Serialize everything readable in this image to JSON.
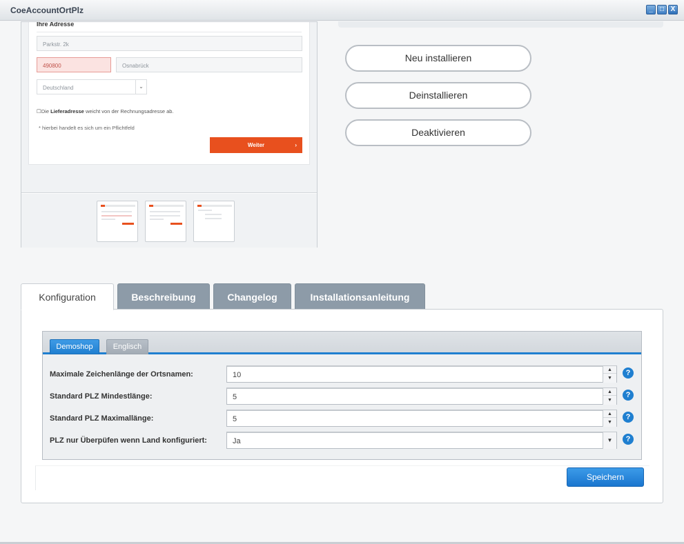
{
  "window": {
    "title": "CoeAccountOrtPlz",
    "controls": {
      "minimize": "_",
      "maximize": "□",
      "close": "X"
    }
  },
  "preview": {
    "heading": "Ihre Adresse",
    "street_value": "Parkstr. 2k",
    "zip_value": "490800",
    "city_value": "Osnabrück",
    "country_value": "Deutschland",
    "checkbox_text_pre": "Die ",
    "checkbox_text_bold": "Lieferadresse",
    "checkbox_text_post": " weicht von der Rechnungsadresse ab.",
    "required_note": "* hierbei handelt es sich um ein Pflichtfeld",
    "next_button": "Weiter",
    "next_arrow": "›",
    "thumbnail_count": 3
  },
  "actions": {
    "reinstall": "Neu installieren",
    "uninstall": "Deinstallieren",
    "deactivate": "Deaktivieren"
  },
  "tabs": [
    {
      "label": "Konfiguration",
      "active": true
    },
    {
      "label": "Beschreibung",
      "active": false
    },
    {
      "label": "Changelog",
      "active": false
    },
    {
      "label": "Installationsanleitung",
      "active": false
    }
  ],
  "config": {
    "subtabs": [
      {
        "label": "Demoshop",
        "active": true
      },
      {
        "label": "Englisch",
        "active": false
      }
    ],
    "rows": [
      {
        "label": "Maximale Zeichenlänge der Ortsnamen:",
        "value": "10",
        "type": "number"
      },
      {
        "label": "Standard PLZ Mindestlänge:",
        "value": "5",
        "type": "number"
      },
      {
        "label": "Standard PLZ Maximallänge:",
        "value": "5",
        "type": "number"
      },
      {
        "label": "PLZ nur Überpüfen wenn Land konfiguriert:",
        "value": "Ja",
        "type": "select"
      }
    ],
    "help_glyph": "?",
    "save_button": "Speichern"
  },
  "colors": {
    "accent_blue": "#1f7fd0",
    "tab_inactive": "#8d9ba8",
    "preview_orange": "#e8501e",
    "error_field": "#fbe3e1"
  }
}
